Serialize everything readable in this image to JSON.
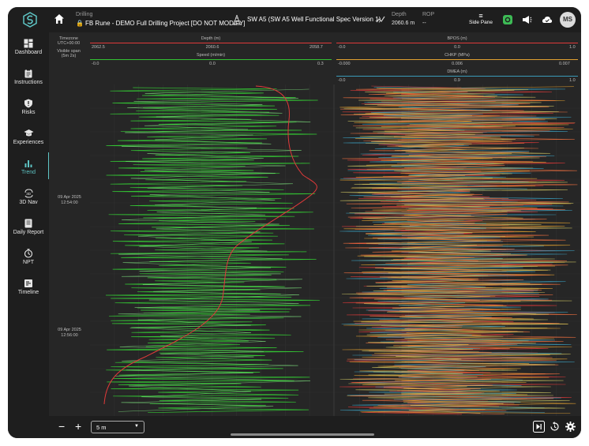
{
  "topbar": {
    "context_label": "Drilling",
    "project_title": "FB Rune - DEMO Full Drilling Project [DO NOT MODIFY]",
    "well_title": "SW A5 (SW A5 Well Functional Spec Version 1)",
    "depth_label": "Depth",
    "depth_value": "2060.6 m",
    "rop_label": "ROP",
    "rop_value": "--",
    "side_pane_label": "Side Pane",
    "avatar_initials": "MS"
  },
  "sidebar": {
    "items": [
      {
        "label": "Dashboard",
        "icon": "dashboard-icon"
      },
      {
        "label": "Instructions",
        "icon": "clipboard-icon"
      },
      {
        "label": "Risks",
        "icon": "shield-icon"
      },
      {
        "label": "Experiences",
        "icon": "graduation-cap-icon"
      },
      {
        "label": "Trend",
        "icon": "bar-chart-icon",
        "active": true
      },
      {
        "label": "3D Nav",
        "icon": "3d-rotate-icon"
      },
      {
        "label": "Daily Report",
        "icon": "report-icon"
      },
      {
        "label": "NPT",
        "icon": "timer-icon"
      },
      {
        "label": "Timeline",
        "icon": "timeline-icon"
      }
    ]
  },
  "track_header": {
    "timezone_label": "Timezone",
    "timezone_value": "UTC+00:00",
    "visible_span_label": "Visible span",
    "visible_span_value": "(5m 2s)",
    "left_track": {
      "curve1": {
        "name": "Depth (m)",
        "min": "2062.5",
        "mid": "2060.6",
        "max": "2058.7",
        "color": "#e03a3a"
      },
      "curve2": {
        "name": "Speed (m/min)",
        "min": "-0.0",
        "mid": "0.0",
        "max": "0.3",
        "color": "#33c233"
      }
    },
    "right_track": {
      "curve1": {
        "name": "BPOS (m)",
        "min": "-0.0",
        "mid": "0.0",
        "max": "1.0",
        "color": "#e03a3a"
      },
      "curve2": {
        "name": "CHKP (MPa)",
        "min": "-0.000",
        "mid": "0.006",
        "max": "0.007",
        "color": "#e0a030"
      },
      "curve3": {
        "name": "DMEA (m)",
        "min": "-0.0",
        "mid": "0.9",
        "max": "1.0",
        "color": "#3a9ab8"
      }
    }
  },
  "time_labels": [
    {
      "date": "09 Apr 2025",
      "time": "12:54:00"
    },
    {
      "date": "09 Apr 2025",
      "time": "12:56:00"
    }
  ],
  "bottombar": {
    "zoom_out": "−",
    "zoom_in": "+",
    "span_select_value": "5 m"
  },
  "colors": {
    "accent": "#5ec4c4",
    "speed_green": "#33c233",
    "depth_red": "#e03a3a"
  }
}
